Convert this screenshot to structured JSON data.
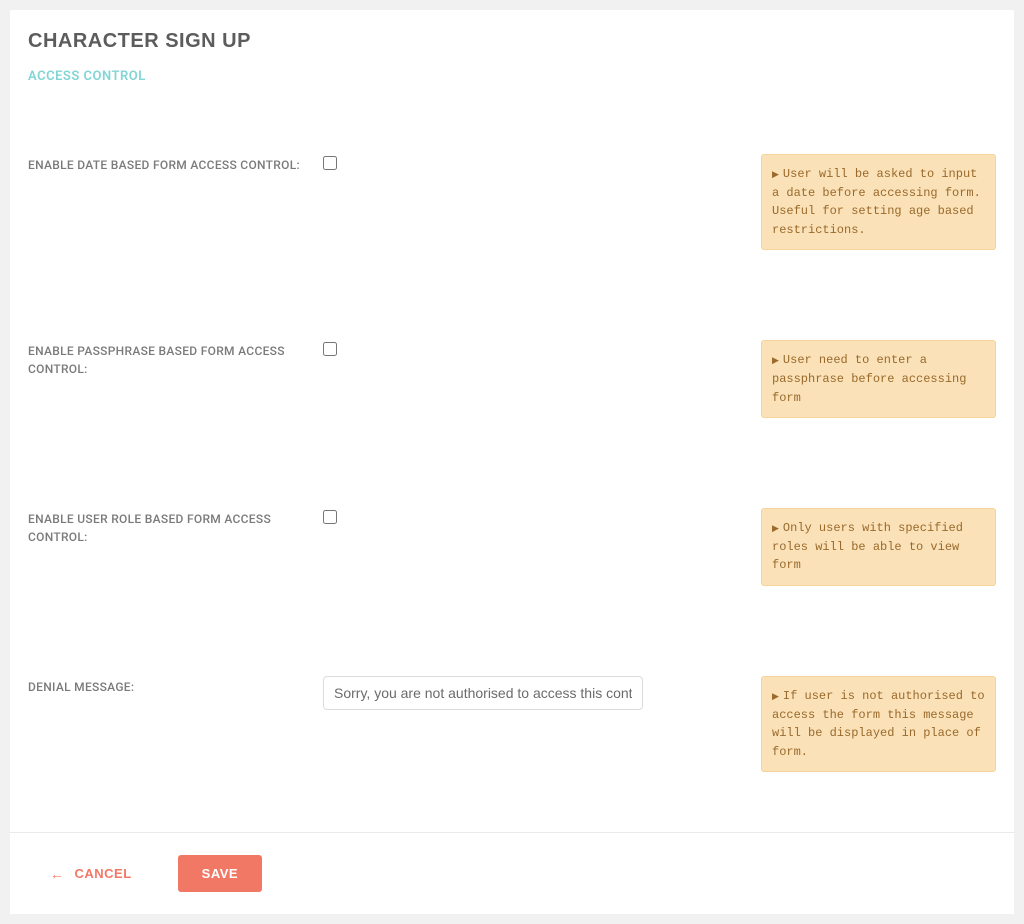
{
  "page": {
    "title": "CHARACTER SIGN UP",
    "section": "ACCESS CONTROL"
  },
  "fields": {
    "date": {
      "label": "ENABLE DATE BASED FORM ACCESS CONTROL:",
      "hint": "User will be asked to input a date before accessing form. Useful for setting age based restrictions."
    },
    "passphrase": {
      "label": "ENABLE PASSPHRASE BASED FORM ACCESS CONTROL:",
      "hint": "User need to enter a passphrase before accessing form"
    },
    "role": {
      "label": "ENABLE USER ROLE BASED FORM ACCESS CONTROL:",
      "hint": "Only users with specified roles will be able to view form"
    },
    "denial": {
      "label": "DENIAL MESSAGE:",
      "value": "Sorry, you are not authorised to access this content.",
      "hint": "If user is not authorised to access the form this message will be displayed in place of form."
    }
  },
  "footer": {
    "cancel": "CANCEL",
    "save": "SAVE"
  }
}
